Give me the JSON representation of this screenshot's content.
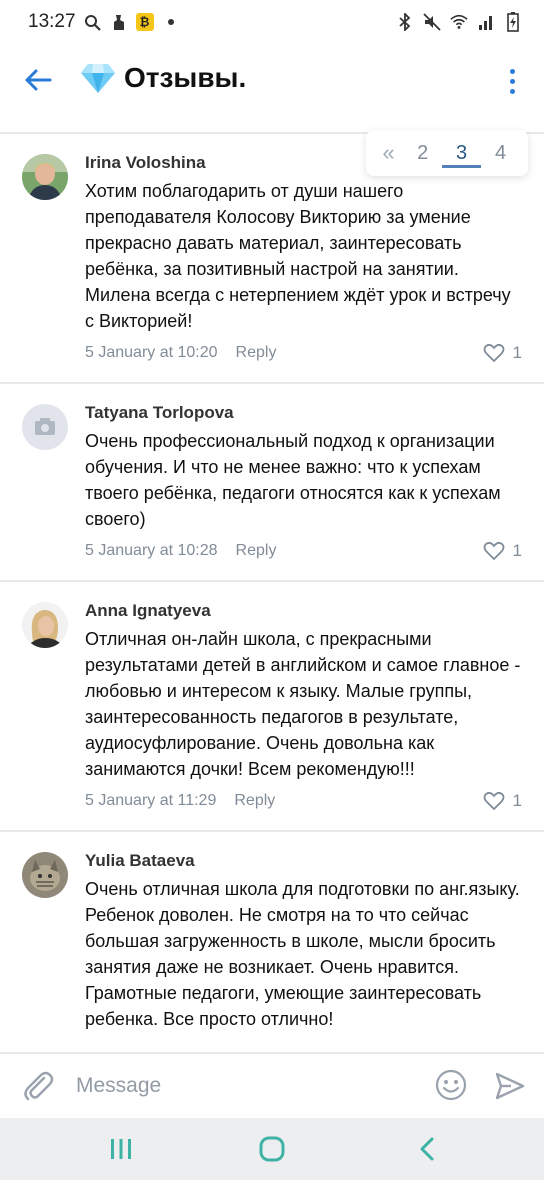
{
  "status_bar": {
    "time": "13:27"
  },
  "header": {
    "title": "Отзывы."
  },
  "pagination": {
    "first": "«",
    "pages": [
      "2",
      "3",
      "4"
    ],
    "active": "3"
  },
  "comments": [
    {
      "author": "Irina Voloshina",
      "text": "Хотим поблагодарить от души нашего преподавателя Колосову Викторию за умение прекрасно давать материал, заинтересовать ребёнка, за  позитивный настрой на занятии. Милена всегда с нетерпением ждёт урок и встречу с Викторией!",
      "date": "5 January at 10:20",
      "reply": "Reply",
      "likes": "1"
    },
    {
      "author": "Tatyana Torlopova",
      "text": "Очень профессиональный подход к организации обучения. И что не менее важно: что к успехам твоего ребёнка, педагоги относятся как к успехам своего)",
      "date": "5 January at 10:28",
      "reply": "Reply",
      "likes": "1"
    },
    {
      "author": "Anna Ignatyeva",
      "text": "Отличная он-лайн школа, с прекрасными результатами детей в английском и самое главное - любовью и интересом к языку. Малые группы, заинтересованность педагогов в результате,  аудиосуфлирование. Очень довольна как занимаются дочки! Всем рекомендую!!!",
      "date": "5 January at 11:29",
      "reply": "Reply",
      "likes": "1"
    },
    {
      "author": "Yulia Bataeva",
      "text": "Очень отличная школа для подготовки по анг.языку. Ребенок доволен. Не смотря на то что сейчас большая загруженность в школе, мысли бросить занятия даже не возникает. Очень нравится. Грамотные педагоги, умеющие заинтересовать ребенка. Все просто отлично!",
      "date": "",
      "reply": "",
      "likes": ""
    }
  ],
  "input": {
    "placeholder": "Message",
    "value": ""
  },
  "colors": {
    "accent": "#2a7ad8",
    "meta": "#818c99",
    "divider": "#e7e8ec",
    "nav": "#3eb3a5"
  },
  "icons": {
    "status": [
      "search-icon",
      "cleaning-icon",
      "app-icon",
      "dot-icon",
      "bluetooth-icon",
      "mute-icon",
      "wifi-icon",
      "signal-icon",
      "battery-icon"
    ],
    "header": [
      "back-arrow-icon",
      "diamond-icon",
      "more-vertical-icon"
    ],
    "input": [
      "paperclip-icon",
      "emoji-icon",
      "send-icon"
    ],
    "nav": [
      "recents-icon",
      "home-icon",
      "back-icon"
    ]
  }
}
